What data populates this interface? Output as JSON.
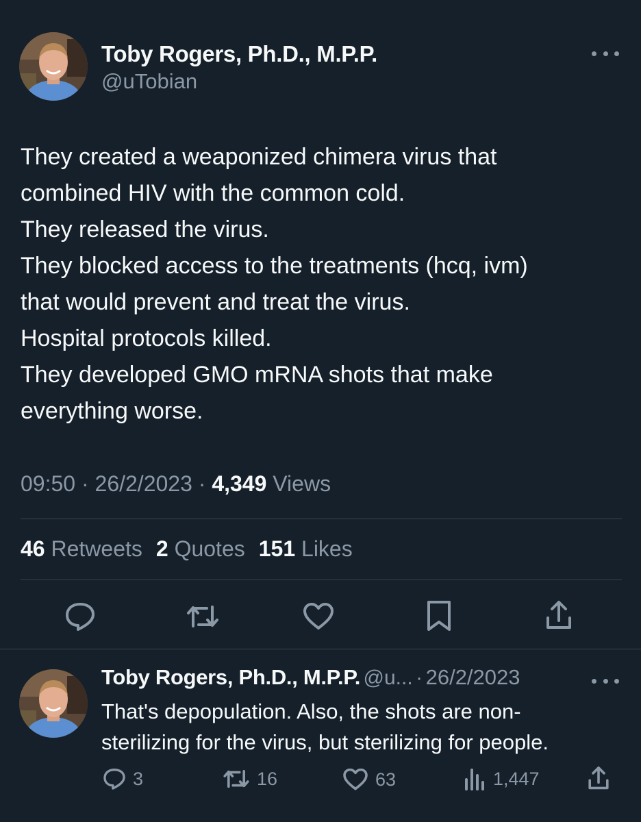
{
  "main_tweet": {
    "author_name": "Toby Rogers, Ph.D., M.P.P.",
    "author_handle": "@uTobian",
    "text_lines": [
      "They created a weaponized chimera virus that",
      "combined HIV with the common cold.",
      "They released the virus.",
      "They blocked access to the treatments (hcq, ivm)",
      "that would prevent and treat the virus.",
      "Hospital protocols killed.",
      "They developed GMO mRNA shots that make",
      "everything worse."
    ],
    "time": "09:50",
    "date": "26/2/2023",
    "views_count": "4,349",
    "views_label": "Views",
    "separator": "·",
    "stats": {
      "retweets_count": "46",
      "retweets_label": "Retweets",
      "quotes_count": "2",
      "quotes_label": "Quotes",
      "likes_count": "151",
      "likes_label": "Likes"
    },
    "actions": [
      "reply-icon",
      "retweet-icon",
      "like-icon",
      "bookmark-icon",
      "share-icon"
    ]
  },
  "reply_tweet": {
    "author_name": "Toby Rogers, Ph.D., M.P.P.",
    "author_handle_truncated": "@u...",
    "separator": "·",
    "date": "26/2/2023",
    "text_lines": [
      "That's depopulation. Also, the shots are non-",
      "sterilizing for the virus, but sterilizing for people."
    ],
    "replies": "3",
    "retweets": "16",
    "likes": "63",
    "views": "1,447"
  },
  "colors": {
    "background": "#15202b",
    "text_primary": "#f7f9f9",
    "text_secondary": "#8b98a5",
    "divider": "#38444d"
  }
}
